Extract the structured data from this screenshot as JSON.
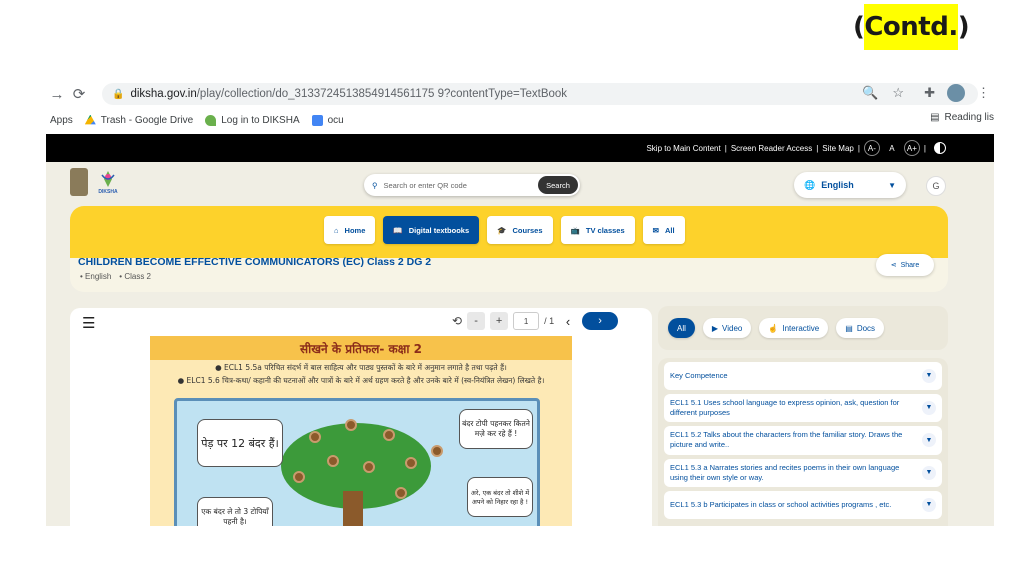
{
  "slide": {
    "contd_label": "(Contd.)"
  },
  "browser": {
    "url_host": "diksha.gov.in",
    "url_path": "/play/collection/do_3133724513854914561175 9?contentType=TextBook",
    "bookmarks": [
      {
        "label": "Apps"
      },
      {
        "label": "Trash - Google Drive"
      },
      {
        "label": "Log in to DIKSHA"
      },
      {
        "label": "ocu"
      }
    ],
    "reading_list": "Reading lis"
  },
  "accessibility": {
    "skip": "Skip to Main Content",
    "reader": "Screen Reader Access",
    "sitemap": "Site Map",
    "a_minus": "A-",
    "a": "A",
    "a_plus": "A+"
  },
  "header": {
    "logo_text": "DIKSHA",
    "search_placeholder": "Search or enter QR code",
    "search_button": "Search",
    "language": "English",
    "avatar_initial": "G"
  },
  "nav": {
    "home": "Home",
    "digital_textbooks": "Digital textbooks",
    "courses": "Courses",
    "tv_classes": "TV classes",
    "all": "All"
  },
  "course": {
    "title": "CHILDREN BECOME EFFECTIVE COMMUNICATORS (EC) Class 2 DG 2",
    "language": "English",
    "class": "Class 2",
    "share": "Share"
  },
  "reader": {
    "page_current": "1",
    "page_total": "/ 1",
    "textbook_title": "सीखने के प्रतिफल- कक्षा 2",
    "line1": "● ECL1 5.5a परिचित संदर्भ में बाल साहित्य और पाठ्य पुस्तकों के बारे में अनुमान लगाते है तथा पढ़ते हैं।",
    "line2": "● ELC1 5.6 चित्र-कथा/ कहानी की घटनाओं और पात्रों के बारे में अर्थ ग्रहण करते है और उनके बारे में (स्व-नियंत्रित लेखन) लिखते है।",
    "bubble1": "पेड़ पर 12 बंदर हैं।",
    "bubble2": "बंदर टोपी पहनकर कितने मज़े कर रहे हैं !",
    "bubble3": "अरे, एक बंदर तो शीशे में अपने को निहार रहा है !",
    "bubble4": "एक बंदर ले तो 3 टोपियाँ पहनी है।"
  },
  "filters": {
    "all": "All",
    "video": "Video",
    "interactive": "Interactive",
    "docs": "Docs"
  },
  "competences": [
    {
      "text": "Key Competence"
    },
    {
      "text": "ECL1 5.1 Uses school language to express opinion, ask, question for different purposes"
    },
    {
      "text": "ECL1 5.2 Talks about the characters from the familiar story. Draws the picture and write.."
    },
    {
      "text": "ECL1 5.3 a Narrates stories and recites poems in their own language using their own style or way."
    },
    {
      "text": "ECL1 5.3 b Participates in class or school activities programs , etc."
    }
  ],
  "colors": {
    "brand": "#024f9d",
    "yellow_band": "#fdd22b",
    "highlight": "#ffff00"
  }
}
